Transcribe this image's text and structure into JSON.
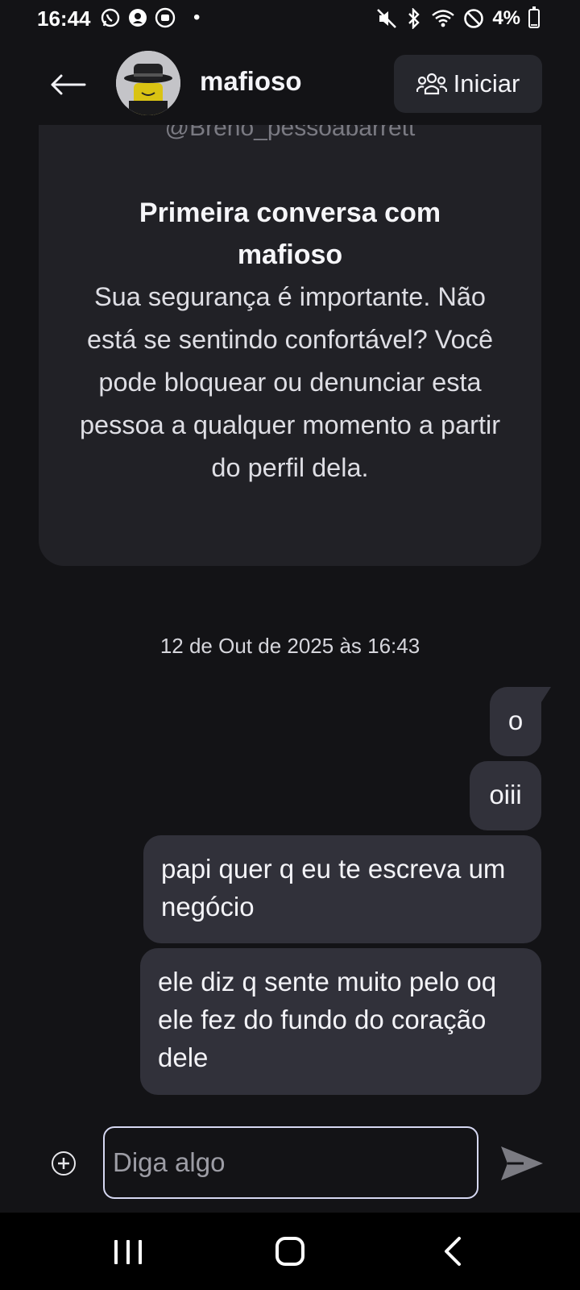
{
  "status_bar": {
    "time": "16:44",
    "battery": "4%",
    "battery_fraction": 0.04
  },
  "header": {
    "contact_name": "mafioso",
    "start_button_label": "Iniciar"
  },
  "intro": {
    "handle": "@Breno_pessoabarrett",
    "title": "Primeira conversa com mafioso",
    "text": "Sua segurança é importante. Não está se sentindo confortável? Você pode bloquear ou denunciar esta pessoa a qualquer momento a partir do perfil dela."
  },
  "conversation": {
    "timestamp": "12 de Out de 2025 às 16:43",
    "messages": [
      {
        "text": "o"
      },
      {
        "text": "oiii"
      },
      {
        "text": "papi quer q eu te escreva um negócio"
      },
      {
        "text": "ele diz q sente muito pelo oq ele fez do fundo do coração dele"
      }
    ]
  },
  "composer": {
    "placeholder": "Diga algo"
  },
  "icons": {
    "back": "arrow-left-icon",
    "start": "group-icon",
    "add": "plus-circle-icon",
    "send": "send-icon"
  },
  "colors": {
    "background": "#131316",
    "card": "#212126",
    "bubble": "#31313a",
    "input_border": "#d6d8f2"
  }
}
